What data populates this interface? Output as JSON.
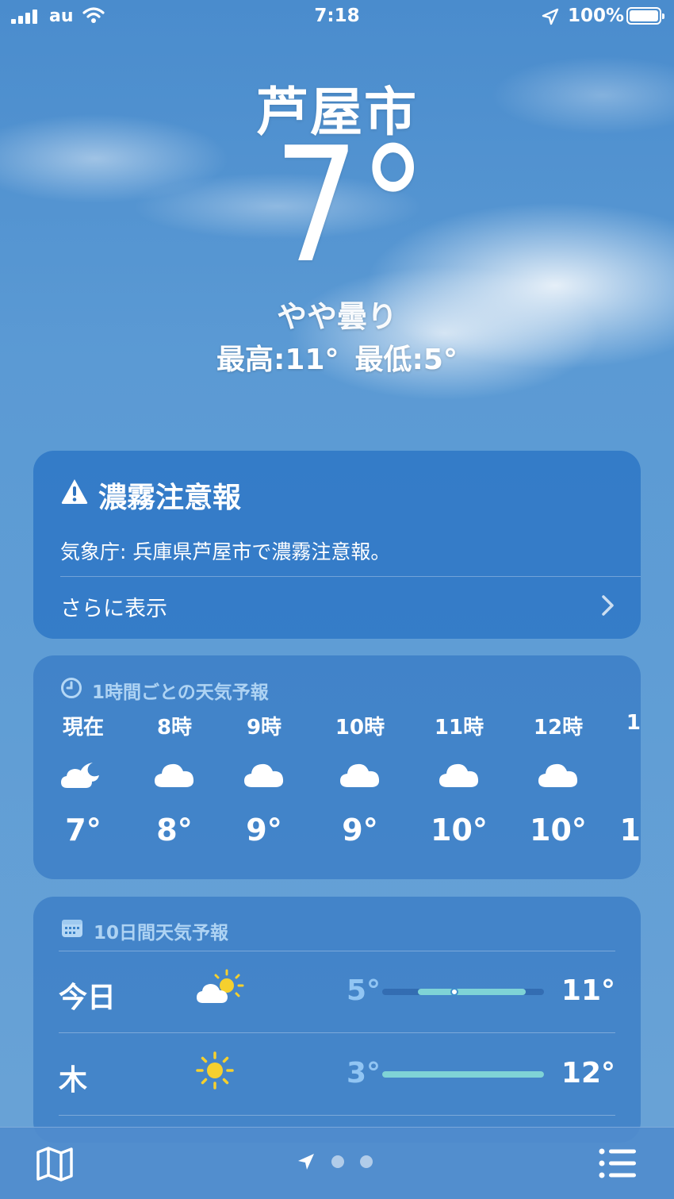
{
  "status": {
    "carrier": "au",
    "time": "7:18",
    "battery": "100%"
  },
  "hero": {
    "city": "芦屋市",
    "temp": "7°",
    "condition": "やや曇り",
    "high": "最高:11°",
    "low": "最低:5°"
  },
  "alert": {
    "title": "濃霧注意報",
    "body": "気象庁: 兵庫県芦屋市で濃霧注意報。",
    "more": "さらに表示"
  },
  "hourly": {
    "header": "1時間ごとの天気予報",
    "items": [
      {
        "label": "現在",
        "icon": "cloud-moon-icon",
        "temp": "7°"
      },
      {
        "label": "8時",
        "icon": "cloud-icon",
        "temp": "8°"
      },
      {
        "label": "9時",
        "icon": "cloud-icon",
        "temp": "9°"
      },
      {
        "label": "10時",
        "icon": "cloud-icon",
        "temp": "9°"
      },
      {
        "label": "11時",
        "icon": "cloud-icon",
        "temp": "10°"
      },
      {
        "label": "12時",
        "icon": "cloud-icon",
        "temp": "10°"
      },
      {
        "label": "1",
        "icon": "cloud-icon",
        "temp": "1"
      }
    ]
  },
  "daily": {
    "header": "10日間天気予報",
    "scale": {
      "min": 3,
      "max": 12
    },
    "current_temp": 7,
    "rows": [
      {
        "day": "今日",
        "icon": "cloud-sun-icon",
        "low": "5°",
        "high": "11°",
        "low_value": 5,
        "high_value": 11
      },
      {
        "day": "木",
        "icon": "sun-icon",
        "low": "3°",
        "high": "12°",
        "low_value": 3,
        "high_value": 12
      }
    ]
  },
  "colors": {
    "range_bar": "#7fd3d6",
    "header_text": "#b4d7f5"
  }
}
